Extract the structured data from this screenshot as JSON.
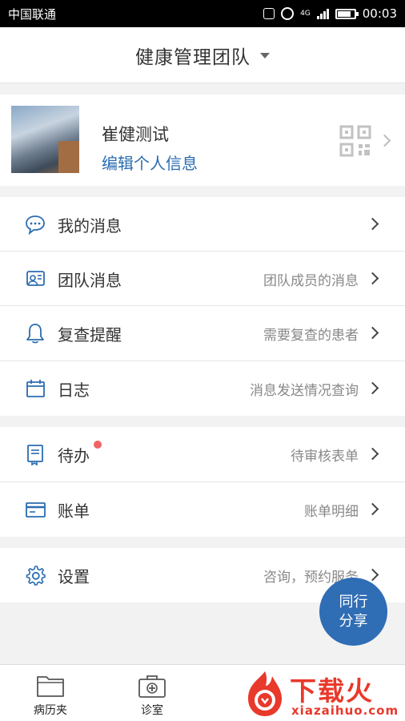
{
  "status_bar": {
    "carrier": "中国联通",
    "network_type": "4G",
    "time": "00:03"
  },
  "header": {
    "title": "健康管理团队"
  },
  "profile": {
    "name": "崔健测试",
    "edit_link": "编辑个人信息"
  },
  "menu_group1": [
    {
      "label": "我的消息",
      "sub": "",
      "icon": "chat-bubble-icon"
    },
    {
      "label": "团队消息",
      "sub": "团队成员的消息",
      "icon": "team-message-icon"
    },
    {
      "label": "复查提醒",
      "sub": "需要复查的患者",
      "icon": "bell-icon"
    },
    {
      "label": "日志",
      "sub": "消息发送情况查询",
      "icon": "calendar-icon"
    }
  ],
  "menu_group2": [
    {
      "label": "待办",
      "sub": "待审核表单",
      "icon": "todo-icon",
      "badge": true
    },
    {
      "label": "账单",
      "sub": "账单明细",
      "icon": "bill-card-icon"
    }
  ],
  "menu_group3": [
    {
      "label": "设置",
      "sub": "咨询，预约服务",
      "icon": "gear-icon"
    }
  ],
  "share_button": {
    "line1": "同行",
    "line2": "分享"
  },
  "tab_bar": [
    {
      "label": "病历夹",
      "icon": "folder-icon"
    },
    {
      "label": "诊室",
      "icon": "medical-kit-icon"
    }
  ],
  "watermark": {
    "brand": "下载火",
    "url": "xiazaihuo.com"
  },
  "colors": {
    "accent": "#2b6cb0",
    "share_bg": "#2f6db5",
    "badge": "#f06464",
    "watermark": "#e8392b"
  }
}
